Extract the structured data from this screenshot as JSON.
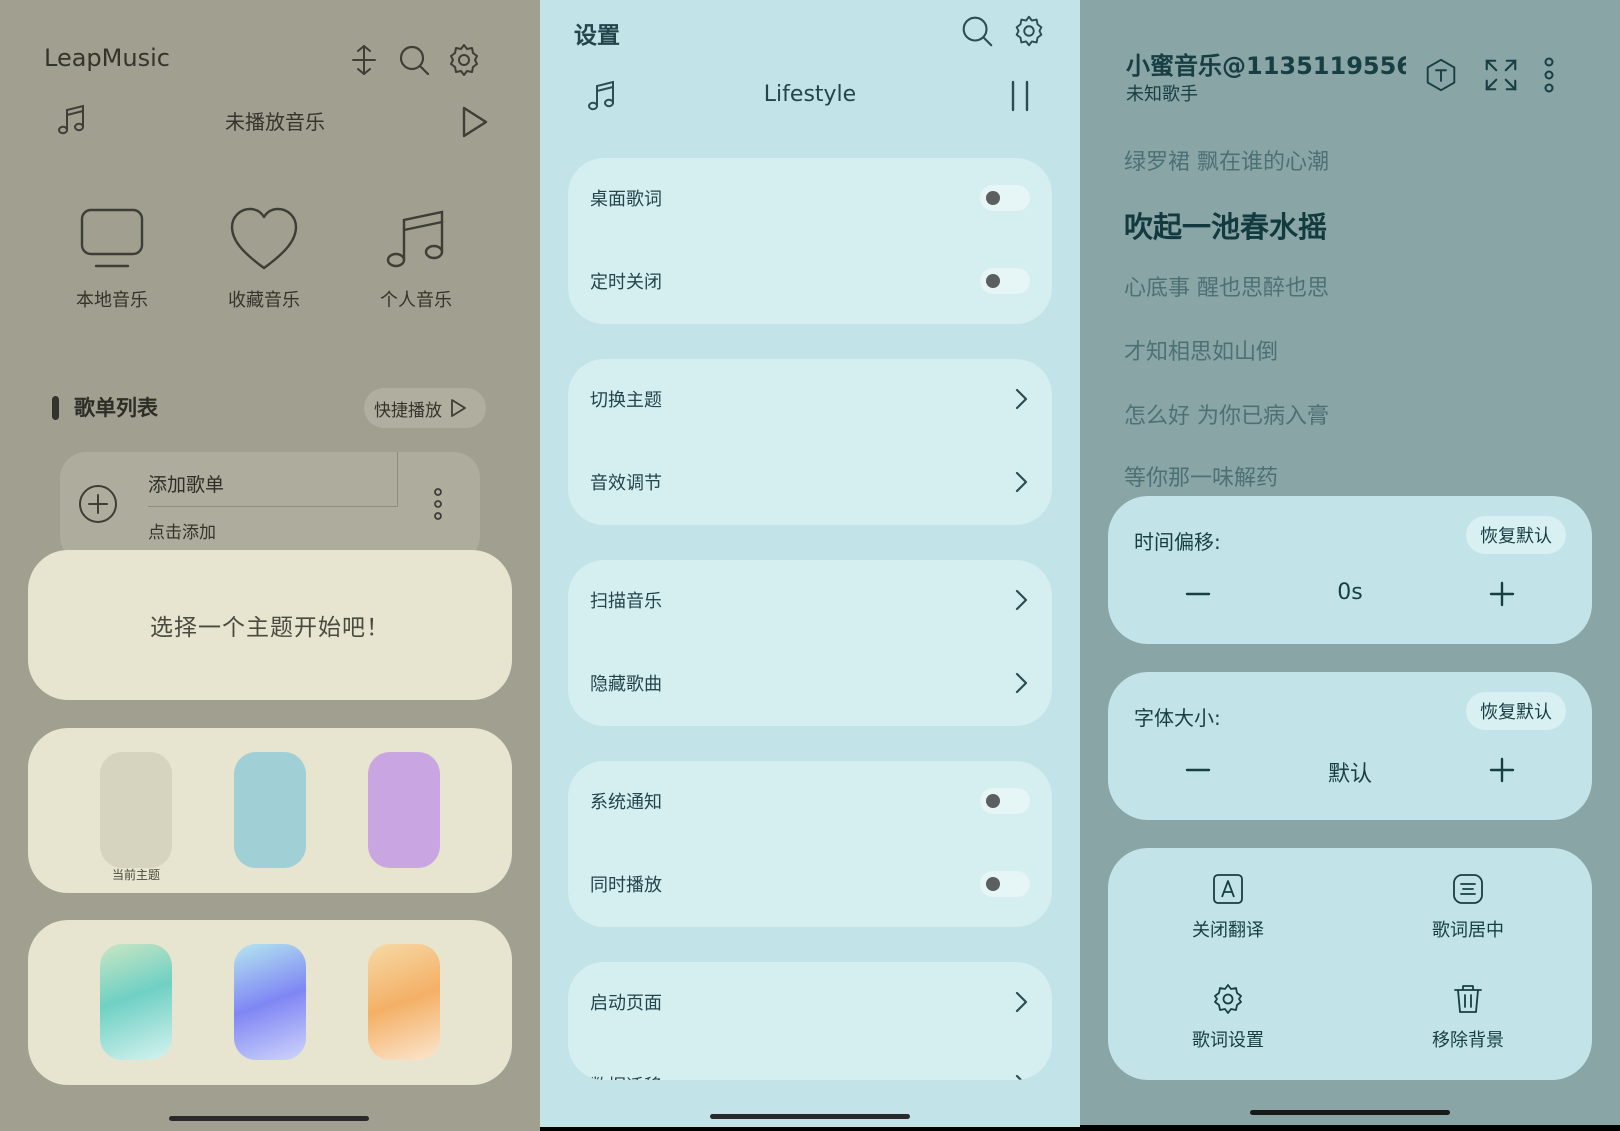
{
  "library_screen": {
    "app_title": "LeapMusic",
    "now_playing": "未播放音乐",
    "quick_access": [
      {
        "label": "本地音乐",
        "icon": "monitor-icon"
      },
      {
        "label": "收藏音乐",
        "icon": "heart-icon"
      },
      {
        "label": "个人音乐",
        "icon": "music-note-icon"
      }
    ],
    "section_title": "歌单列表",
    "quick_play_label": "快捷播放",
    "playlist": {
      "name": "添加歌单",
      "subtitle": "点击添加"
    },
    "theme_prompt": "选择一个主题开始吧！",
    "current_theme_caption": "当前主题",
    "theme_colors": [
      "#d6d4be",
      "#a0cfd5",
      "#c9a5e2"
    ]
  },
  "settings_screen": {
    "title": "设置",
    "now_playing": "Lifestyle",
    "groups": [
      [
        {
          "label": "桌面歌词",
          "control": "toggle"
        },
        {
          "label": "定时关闭",
          "control": "toggle"
        }
      ],
      [
        {
          "label": "切换主题",
          "control": "chevron"
        },
        {
          "label": "音效调节",
          "control": "chevron"
        }
      ],
      [
        {
          "label": "扫描音乐",
          "control": "chevron"
        },
        {
          "label": "隐藏歌曲",
          "control": "chevron"
        }
      ],
      [
        {
          "label": "系统通知",
          "control": "toggle"
        },
        {
          "label": "同时播放",
          "control": "toggle"
        }
      ],
      [
        {
          "label": "启动页面",
          "control": "chevron"
        },
        {
          "label": "数据迁移",
          "control": "chevron"
        }
      ]
    ]
  },
  "lyrics_screen": {
    "song_title": "小蜜音乐@1135119556...",
    "artist": "未知歌手",
    "lyrics": [
      {
        "text": "绿罗裙 飘在谁的心潮",
        "current": false
      },
      {
        "text": "吹起一池春水摇",
        "current": true
      },
      {
        "text": "心底事 醒也思醉也思",
        "current": false
      },
      {
        "text": "才知相思如山倒",
        "current": false
      },
      {
        "text": "怎么好 为你已病入膏",
        "current": false
      },
      {
        "text": "等你那一味解药",
        "current": false
      }
    ],
    "time_offset": {
      "label": "时间偏移:",
      "reset": "恢复默认",
      "value": "0s"
    },
    "font_size": {
      "label": "字体大小:",
      "reset": "恢复默认",
      "value": "默认"
    },
    "actions": [
      {
        "label": "关闭翻译",
        "icon": "translate-icon"
      },
      {
        "label": "歌词居中",
        "icon": "align-center-icon"
      },
      {
        "label": "歌词设置",
        "icon": "gear-icon"
      },
      {
        "label": "移除背景",
        "icon": "trash-icon"
      }
    ]
  },
  "colors": {
    "library_bg": "#a19f90",
    "library_card": "#e7e5d0",
    "settings_bg": "#c2e3e7",
    "settings_card": "#d5eef0",
    "lyrics_bg": "#8aa5a6",
    "lyrics_card": "#c2e3e7"
  }
}
